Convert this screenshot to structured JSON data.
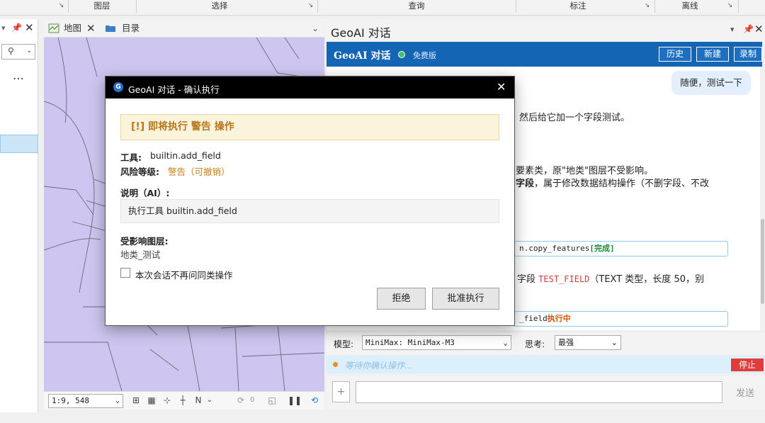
{
  "ribbon": {
    "groups": [
      "图层",
      "选择",
      "查询",
      "标注",
      "离线"
    ]
  },
  "map_pane": {
    "tab_map": "地图",
    "tab_catalog": "目录",
    "scale": "1:9, 548"
  },
  "geoai_pane": {
    "pane_title": "GeoAI 对话",
    "header_title": "GeoAI 对话",
    "plan": "免费版",
    "btn_history": "历史",
    "btn_new": "新建",
    "btn_record": "录制",
    "user_message": "随便，测试一下",
    "line1": "然后给它加一个字段测试。",
    "line2": "要素类，原\"地类\"图层不受影响。",
    "line3_bold": "字段",
    "line3_rest": "，属于修改数据结构操作（不删字段、不改",
    "code1_text": "n.copy_features",
    "code1_status": "[完成]",
    "line4_pre": "字段",
    "line4_code": "TEST_FIELD",
    "line4_post": "（TEXT 类型，长度 50，别",
    "code2_text": "_field",
    "code2_status": "执行中",
    "model_label": "模型:",
    "model_value": "MiniMax: MiniMax-M3",
    "think_label": "思考:",
    "think_value": "最强",
    "status_text": "等待你确认操作...",
    "stop_button": "停止",
    "add_button": "+",
    "send_button": "发送"
  },
  "dialog": {
    "title": "GeoAI 对话 - 确认执行",
    "warning_banner": "[!] 即将执行 警告 操作",
    "tool_label": "工具:",
    "tool_value": "builtin.add_field",
    "risk_label": "风险等级:",
    "risk_value": "警告（可撤销）",
    "desc_label": "说明（AI）:",
    "desc_value": "执行工具 builtin.add_field",
    "layers_label": "受影响图层:",
    "layers_value": "地类_测试",
    "checkbox_label": "本次会话不再问同类操作",
    "reject_button": "拒绝",
    "approve_button": "批准执行"
  },
  "colors": {
    "header_blue": "#1565b5",
    "map_fill": "#cec6f0",
    "warning_banner_bg": "#fcf3dc",
    "warning_text": "#b6761a",
    "code_red": "#d33a3a",
    "stop_red": "#e03c3c"
  }
}
